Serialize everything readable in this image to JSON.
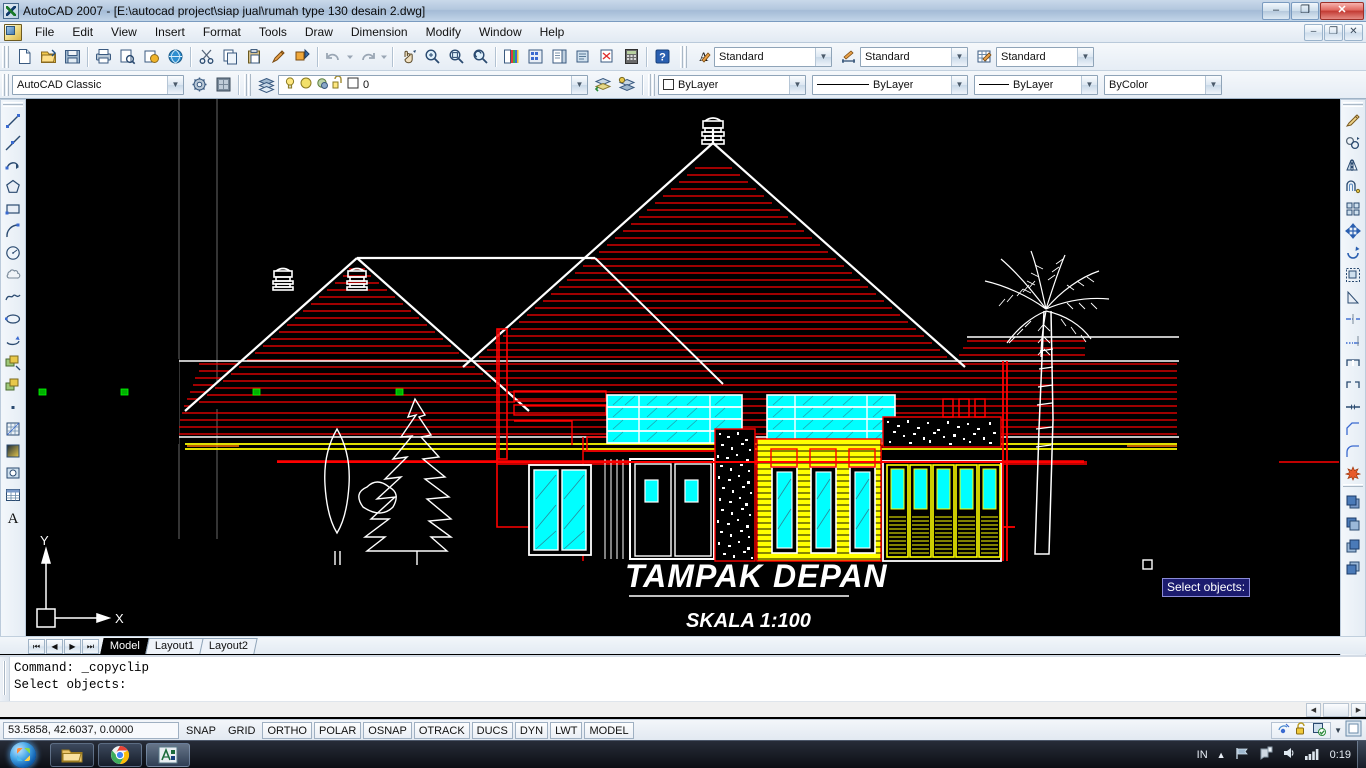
{
  "window": {
    "title": "AutoCAD 2007 - [E:\\autocad project\\siap jual\\rumah type 130 desain 2.dwg]",
    "minimize_label": "–",
    "restore_label": "❐",
    "close_label": "✕"
  },
  "mdi_buttons": {
    "minimize": "–",
    "restore": "❐",
    "close": "✕"
  },
  "menu": {
    "items": [
      {
        "label": "File"
      },
      {
        "label": "Edit"
      },
      {
        "label": "View"
      },
      {
        "label": "Insert"
      },
      {
        "label": "Format"
      },
      {
        "label": "Tools"
      },
      {
        "label": "Draw"
      },
      {
        "label": "Dimension"
      },
      {
        "label": "Modify"
      },
      {
        "label": "Window"
      },
      {
        "label": "Help"
      }
    ]
  },
  "standard_toolbar": {
    "icons": [
      "new-file-icon",
      "open-folder-icon",
      "save-icon",
      "plot-icon",
      "plot-preview-icon",
      "publish-icon",
      "publish-web-icon",
      "cut-icon",
      "copy-icon",
      "paste-icon",
      "match-properties-icon",
      "block-editor-icon",
      "undo-icon",
      "undo-dropdown-icon",
      "redo-icon",
      "redo-dropdown-icon",
      "pan-realtime-icon",
      "zoom-realtime-icon",
      "zoom-window-icon",
      "zoom-previous-icon",
      "properties-icon",
      "designcenter-icon",
      "tool-palettes-icon",
      "sheet-set-icon",
      "markup-set-icon",
      "quickcalc-icon",
      "help-icon"
    ]
  },
  "styles_toolbar": {
    "text_style": {
      "icon": "text-style-icon",
      "value": "Standard"
    },
    "dim_style": {
      "icon": "dimension-style-icon",
      "value": "Standard"
    },
    "table_style": {
      "icon": "table-style-icon",
      "value": "Standard"
    }
  },
  "workspace_toolbar": {
    "workspace": {
      "value": "AutoCAD Classic"
    },
    "workspace_settings_icon": "gear-icon",
    "my_workspace_icon": "my-workspace-icon"
  },
  "layer_toolbar": {
    "layer_properties_icon": "layer-properties-icon",
    "state_icons": [
      "lightbulb-on-icon",
      "freeze-sun-icon",
      "lock-open-icon",
      "plot-icon"
    ],
    "current_layer": "0",
    "previous_layer_icon": "layer-previous-icon",
    "make_current_icon": "make-object-layer-current-icon"
  },
  "properties_toolbar": {
    "color": {
      "value": "ByLayer",
      "swatch_icon": "color-swatch-icon"
    },
    "linetype": {
      "value": "ByLayer"
    },
    "lineweight": {
      "value": "ByLayer"
    },
    "plot_style": {
      "value": "ByColor"
    }
  },
  "draw_toolbar": {
    "title": "Draw",
    "tools": [
      {
        "name": "line-icon"
      },
      {
        "name": "construction-line-icon"
      },
      {
        "name": "polyline-icon"
      },
      {
        "name": "polygon-icon"
      },
      {
        "name": "rectangle-icon"
      },
      {
        "name": "arc-icon"
      },
      {
        "name": "circle-icon"
      },
      {
        "name": "revision-cloud-icon"
      },
      {
        "name": "spline-icon"
      },
      {
        "name": "ellipse-icon"
      },
      {
        "name": "ellipse-arc-icon"
      },
      {
        "name": "insert-block-icon"
      },
      {
        "name": "make-block-icon"
      },
      {
        "name": "point-icon"
      },
      {
        "name": "hatch-icon"
      },
      {
        "name": "gradient-icon"
      },
      {
        "name": "region-icon"
      },
      {
        "name": "table-icon"
      },
      {
        "name": "multiline-text-icon"
      }
    ]
  },
  "modify_toolbar": {
    "title": "Modify",
    "tools": [
      {
        "name": "erase-icon"
      },
      {
        "name": "copy-icon"
      },
      {
        "name": "mirror-icon"
      },
      {
        "name": "offset-icon"
      },
      {
        "name": "array-icon"
      },
      {
        "name": "move-icon"
      },
      {
        "name": "rotate-icon"
      },
      {
        "name": "scale-icon"
      },
      {
        "name": "stretch-icon"
      },
      {
        "name": "trim-icon"
      },
      {
        "name": "extend-icon"
      },
      {
        "name": "break-at-point-icon"
      },
      {
        "name": "break-icon"
      },
      {
        "name": "join-icon"
      },
      {
        "name": "chamfer-icon"
      },
      {
        "name": "fillet-icon"
      },
      {
        "name": "explode-icon"
      }
    ],
    "draworder_tools": [
      {
        "name": "bring-to-front-icon"
      },
      {
        "name": "send-to-back-icon"
      },
      {
        "name": "bring-above-object-icon"
      },
      {
        "name": "send-under-object-icon"
      }
    ]
  },
  "drawing": {
    "title_text": "TAMPAK DEPAN",
    "scale_text": "SKALA 1:100",
    "ucs_x_label": "X",
    "ucs_y_label": "Y",
    "tooltip": "Select objects:",
    "colors": {
      "background": "#000000",
      "roof_red": "#ff0000",
      "outline_white": "#ffffff",
      "glass_cyan": "#00ffff",
      "wood_yellow": "#ffff00",
      "grip_green": "#00b000"
    }
  },
  "layout_tabs": {
    "nav": [
      "⏮",
      "◀",
      "▶",
      "⏭"
    ],
    "tabs": [
      {
        "label": "Model",
        "active": true
      },
      {
        "label": "Layout1",
        "active": false
      },
      {
        "label": "Layout2",
        "active": false
      }
    ]
  },
  "command_window": {
    "lines": [
      "Command: _copyclip",
      "Select objects:"
    ]
  },
  "status_bar": {
    "coordinates": "53.5858, 42.6037, 0.0000",
    "toggles": [
      {
        "label": "SNAP",
        "raised": false
      },
      {
        "label": "GRID",
        "raised": false
      },
      {
        "label": "ORTHO",
        "raised": true
      },
      {
        "label": "POLAR",
        "raised": true
      },
      {
        "label": "OSNAP",
        "raised": true
      },
      {
        "label": "OTRACK",
        "raised": true
      },
      {
        "label": "DUCS",
        "raised": true
      },
      {
        "label": "DYN",
        "raised": false
      },
      {
        "label": "LWT",
        "raised": false
      },
      {
        "label": "MODEL",
        "raised": true
      }
    ],
    "tray_icons": [
      "communication-center-icon",
      "unlock-toolbars-icon",
      "manage-xrefs-icon"
    ],
    "tray_expand_icon": "chevron-down-icon",
    "clean_screen_icon": "clean-screen-icon"
  },
  "taskbar": {
    "start_label": "Start",
    "apps": [
      {
        "name": "windows-explorer-icon"
      },
      {
        "name": "google-chrome-icon"
      },
      {
        "name": "autocad-icon",
        "active": true
      }
    ],
    "language": "IN",
    "tray": [
      "show-hidden-icons-icon",
      "network-flag-icon",
      "action-center-icon",
      "volume-icon",
      "signal-bars-icon"
    ],
    "clock": "0:19"
  }
}
